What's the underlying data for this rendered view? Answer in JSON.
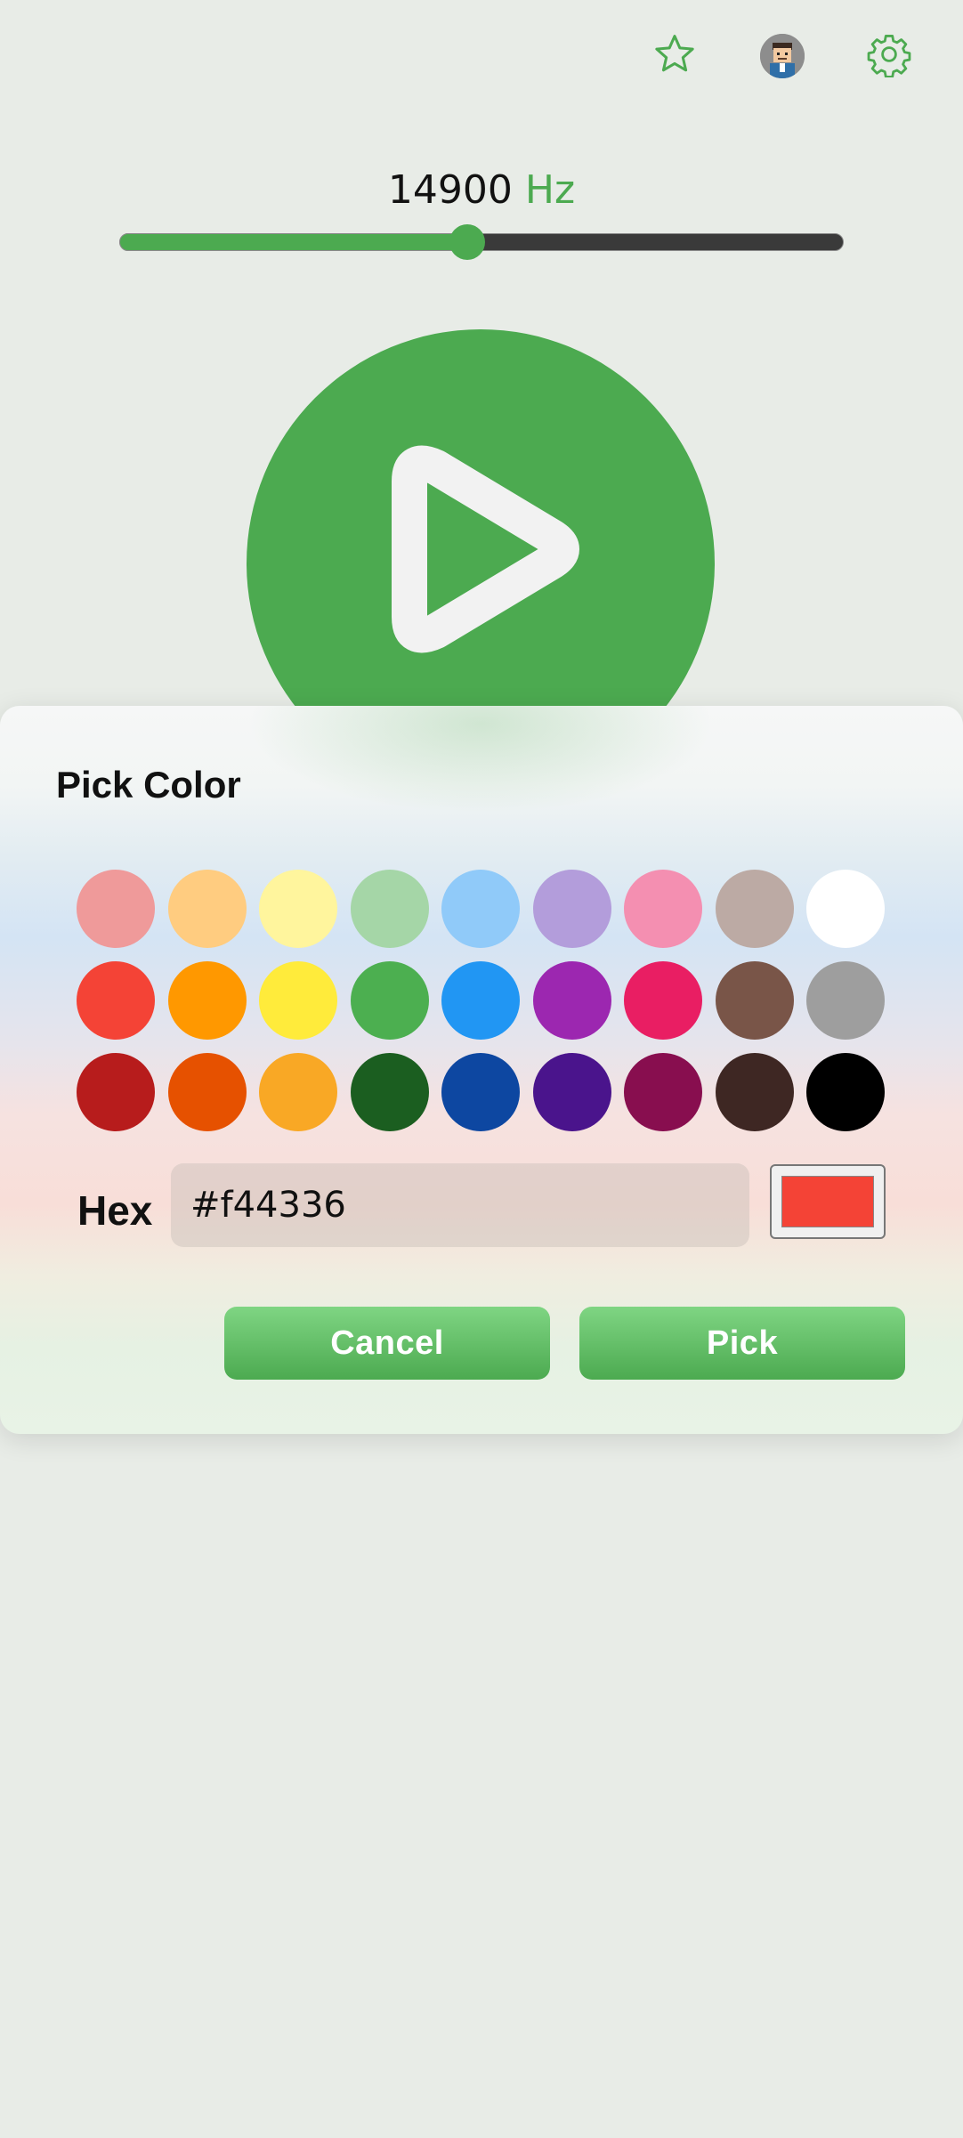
{
  "toolbar": {
    "favorite_icon": "star-icon",
    "avatar_icon": "avatar-icon",
    "settings_icon": "gear-icon"
  },
  "frequency": {
    "value": "14900",
    "unit": "Hz",
    "slider_fraction": 0.48
  },
  "play_icon": "play-icon",
  "dialog": {
    "title": "Pick Color",
    "swatches": [
      [
        "#ef9a9a",
        "#ffcc80",
        "#fff59d",
        "#a5d6a7",
        "#90caf9",
        "#b39ddb",
        "#f48fb1",
        "#bcaaa4",
        "#ffffff"
      ],
      [
        "#f44336",
        "#ff9800",
        "#ffeb3b",
        "#4caf50",
        "#2196f3",
        "#9c27b0",
        "#e91e63",
        "#795548",
        "#9e9e9e"
      ],
      [
        "#b71c1c",
        "#e65100",
        "#f9a825",
        "#1b5e20",
        "#0d47a1",
        "#4a148c",
        "#880e4f",
        "#3e2723",
        "#000000"
      ]
    ],
    "hex_label": "Hex",
    "hex_value": "#f44336",
    "preview_color": "#f44336",
    "cancel_label": "Cancel",
    "pick_label": "Pick"
  },
  "colors": {
    "accent": "#4caa50",
    "background": "#e8ece7"
  }
}
